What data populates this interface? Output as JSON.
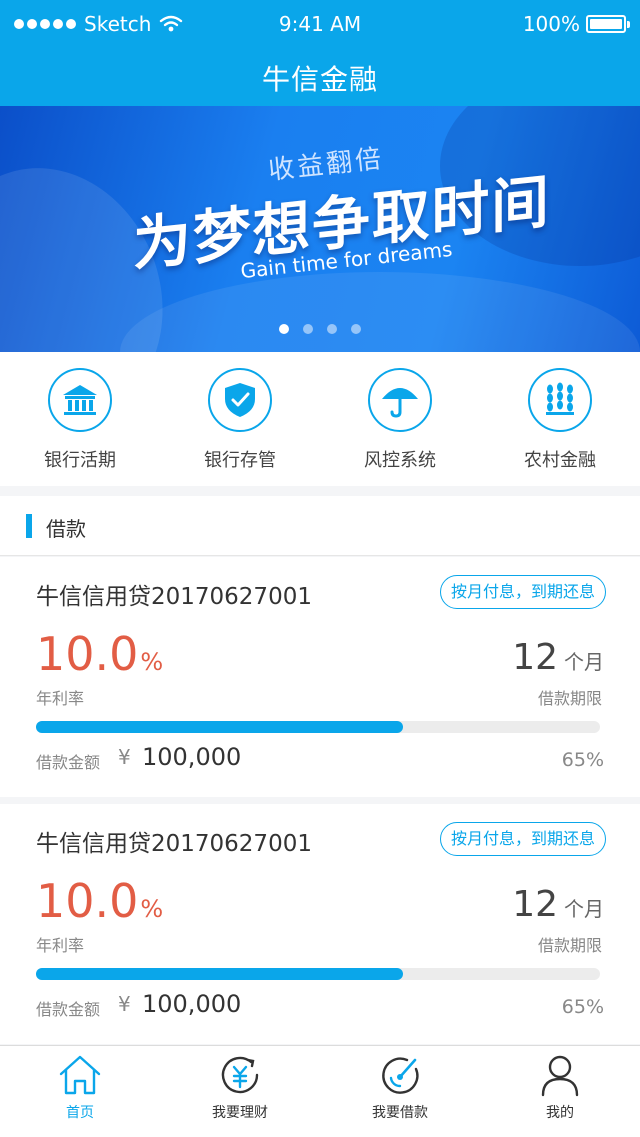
{
  "status_bar": {
    "carrier": "Sketch",
    "time": "9:41 AM",
    "battery": "100%"
  },
  "header": {
    "title": "牛信金融"
  },
  "banner": {
    "subtitle": "收益翻倍",
    "headline": "为梦想争取时间",
    "english": "Gain time for dreams",
    "slide_count": 4,
    "active_slide": 1
  },
  "quick_links": [
    {
      "label": "银行活期",
      "icon": "bank-icon"
    },
    {
      "label": "银行存管",
      "icon": "shield-check-icon"
    },
    {
      "label": "风控系统",
      "icon": "umbrella-icon"
    },
    {
      "label": "农村金融",
      "icon": "wheat-icon"
    }
  ],
  "section": {
    "title": "借款"
  },
  "loans": [
    {
      "name": "牛信信用贷20170627001",
      "repayment": "按月付息，到期还息",
      "rate": "10.0",
      "rate_unit": "%",
      "rate_label": "年利率",
      "term": "12",
      "term_unit": "个月",
      "term_label": "借款期限",
      "amount_label": "借款金额",
      "currency": "¥",
      "amount": "100,000",
      "progress": 65,
      "progress_text": "65%"
    },
    {
      "name": "牛信信用贷20170627001",
      "repayment": "按月付息，到期还息",
      "rate": "10.0",
      "rate_unit": "%",
      "rate_label": "年利率",
      "term": "12",
      "term_unit": "个月",
      "term_label": "借款期限",
      "amount_label": "借款金额",
      "currency": "¥",
      "amount": "100,000",
      "progress": 65,
      "progress_text": "65%"
    }
  ],
  "tabs": [
    {
      "label": "首页",
      "icon": "home-icon",
      "active": true
    },
    {
      "label": "我要理财",
      "icon": "invest-icon",
      "active": false
    },
    {
      "label": "我要借款",
      "icon": "borrow-icon",
      "active": false
    },
    {
      "label": "我的",
      "icon": "user-icon",
      "active": false
    }
  ],
  "colors": {
    "primary": "#0aa6ea",
    "rate": "#e25d45"
  }
}
